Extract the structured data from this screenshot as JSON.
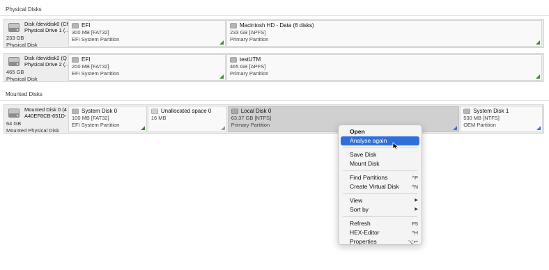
{
  "physical": {
    "header": "Physical Disks",
    "disks": [
      {
        "title1": "Disk /dev/disk0 (Ch",
        "title2": "Physical Drive 1 (…",
        "size": "233 GB",
        "type": "Physical Disk",
        "partitions": [
          {
            "name": "EFI",
            "size": "300 MB [FAT32]",
            "desc": "EFI System Partition"
          },
          {
            "name": "Macintosh HD - Data (6 disks)",
            "size": "233 GB [APFS]",
            "desc": "Primary Partition"
          }
        ]
      },
      {
        "title1": "Disk /dev/disk2 (Q",
        "title2": "Physical Drive 2 (…",
        "size": "465 GB",
        "type": "Physical Disk",
        "partitions": [
          {
            "name": "EFI",
            "size": "200 MB [FAT32]",
            "desc": "EFI System Partition"
          },
          {
            "name": "testUTM",
            "size": "465 GB [APFS]",
            "desc": "Primary Partition"
          }
        ]
      }
    ]
  },
  "mounted": {
    "header": "Mounted Disks",
    "disk": {
      "title1": "Mounted Disk 0 (4",
      "title2": "A40EF8CB-651D-",
      "size": "64 GB",
      "type": "Mounted Physical Disk",
      "partitions": [
        {
          "name": "System Disk 0",
          "size": "100 MB [FAT32]",
          "desc": "EFI System Partition"
        },
        {
          "name": "Unallocated space 0",
          "size": "16 MB",
          "desc": ""
        },
        {
          "name": "Local Disk 0",
          "size": "63.37 GB [NTFS]",
          "desc": "Primary Partition"
        },
        {
          "name": "System Disk 1",
          "size": "530 MB [NTFS]",
          "desc": "OEM Partition"
        }
      ]
    }
  },
  "context_menu": {
    "open": "Open",
    "analyse_again": "Analyse again",
    "save_disk": "Save Disk",
    "mount_disk": "Mount Disk",
    "find_partitions": "Find Partitions",
    "find_partitions_sc": "^P",
    "create_virtual_disk": "Create Virtual Disk",
    "create_virtual_disk_sc": "^N",
    "view": "View",
    "sort_by": "Sort by",
    "submenu_arrow": "▶",
    "refresh": "Refresh",
    "refresh_sc": "F5",
    "hex_editor": "HEX-Editor",
    "hex_editor_sc": "^H",
    "properties": "Properties",
    "properties_sc": "⌥↩"
  },
  "colors": {
    "selection": "#2f6fdb",
    "corner_green": "#3c8d2f",
    "corner_blue": "#3b6fd6"
  }
}
